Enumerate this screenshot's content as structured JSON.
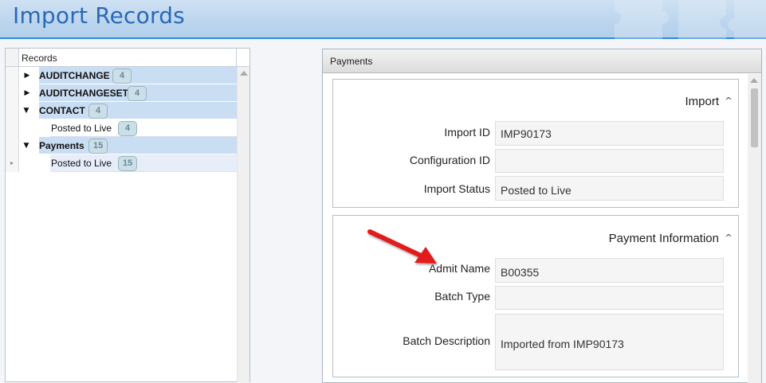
{
  "header": {
    "title": "Import Records"
  },
  "tree": {
    "column_header": "Records",
    "rows": [
      {
        "label": "AUDITCHANGE",
        "count": "4",
        "expanded": false
      },
      {
        "label": "AUDITCHANGESET",
        "count": "4",
        "expanded": false
      },
      {
        "label": "CONTACT",
        "count": "4",
        "expanded": true
      },
      {
        "label": "Posted to Live",
        "count": "4"
      },
      {
        "label": "Payments",
        "count": "15",
        "expanded": true
      },
      {
        "label": "Posted to Live",
        "count": "15"
      }
    ]
  },
  "payments": {
    "title": "Payments",
    "import_section": {
      "title": "Import",
      "fields": [
        {
          "label": "Import ID",
          "value": "IMP90173"
        },
        {
          "label": "Configuration ID",
          "value": ""
        },
        {
          "label": "Import Status",
          "value": "Posted to Live"
        }
      ]
    },
    "payment_section": {
      "title": "Payment Information",
      "fields": [
        {
          "label": "Admit Name",
          "value": "B00355"
        },
        {
          "label": "Batch Type",
          "value": ""
        },
        {
          "label": "Batch Description",
          "value": "Imported from IMP90173"
        }
      ]
    }
  },
  "colors": {
    "accent": "#2f8ad8",
    "title_text": "#2a69b8",
    "row_highlight": "#c9ddf3",
    "annotation_arrow": "#e21b1b"
  },
  "icons": [
    "expand-arrow-icon",
    "collapse-arrow-icon",
    "chevron-up-icon",
    "red-pointer-arrow"
  ]
}
